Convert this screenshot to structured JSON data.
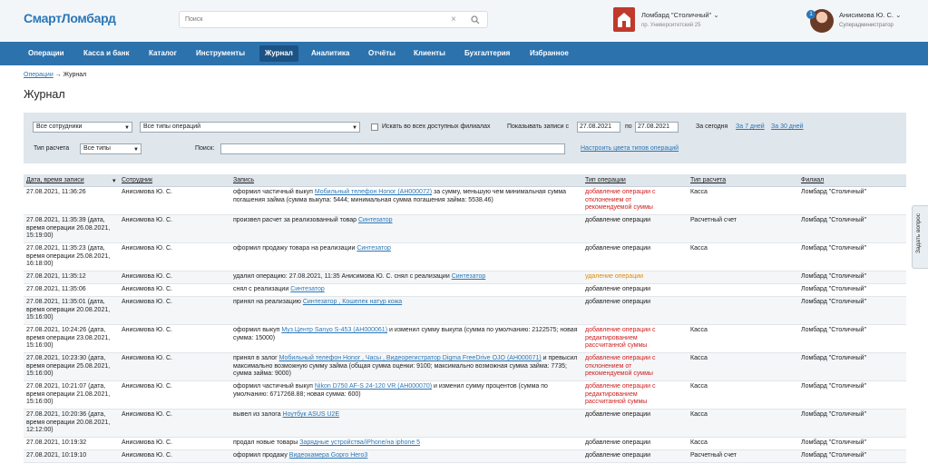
{
  "header": {
    "logo": "СмартЛомбард",
    "search_placeholder": "Поиск",
    "store_name": "Ломбард \"Столичный\"",
    "store_address": "пр. Университетский 25",
    "user_badge": "1",
    "user_name": "Анисимова Ю. С.",
    "user_role": "Суперадминистратор"
  },
  "nav": [
    "Операции",
    "Касса и банк",
    "Каталог",
    "Инструменты",
    "Журнал",
    "Аналитика",
    "Отчёты",
    "Клиенты",
    "Бухгалтерия",
    "Избранное"
  ],
  "nav_active": "Журнал",
  "breadcrumb": {
    "parent": "Операции",
    "separator": "→",
    "current": "Журнал"
  },
  "page_title": "Журнал",
  "filter": {
    "employee": "Все сотрудники",
    "op_type": "Все типы операций",
    "search_all_label": "Искать во всех доступных филиалах",
    "show_records_label": "Показывать записи с",
    "date_from": "27.08.2021",
    "to_label": "по",
    "date_to": "27.08.2021",
    "today": "За сегодня",
    "week": "За 7 дней",
    "month": "За 30 дней",
    "calc_label": "Тип расчета",
    "calc_value": "Все типы",
    "search_label": "Поиск:",
    "colors_link": "Настроить цвета типов операций"
  },
  "columns": [
    "Дата, время записи",
    "Сотрудник",
    "Запись",
    "Тип операции",
    "Тип расчета",
    "Филиал"
  ],
  "rows": [
    {
      "date": "27.08.2021, 11:36:26",
      "emp": "Анисимова Ю. С.",
      "pre": "оформил частичный выкуп ",
      "link": "Мобильный телефон Honor (АН000072)",
      "post": " за сумму, меньшую чем минимальная сумма погашения займа (сумма выкупа: 5444; минимальная сумма погашения займа: 5538.46)",
      "op": "добавление операции с отклонением от рекомендуемой суммы",
      "opc": "red",
      "calc": "Касса",
      "branch": "Ломбард \"Столичный\""
    },
    {
      "date": "27.08.2021, 11:35:39 (дата, время операции 26.08.2021, 15:19:00)",
      "emp": "Анисимова Ю. С.",
      "pre": "произвел расчет за реализованный товар ",
      "link": "Синтезатор",
      "post": "",
      "op": "добавление операции",
      "opc": "",
      "calc": "Расчетный счет",
      "branch": "Ломбард \"Столичный\""
    },
    {
      "date": "27.08.2021, 11:35:23 (дата, время операции 25.08.2021, 16:18:00)",
      "emp": "Анисимова Ю. С.",
      "pre": "оформил продажу товара на реализации ",
      "link": "Синтезатор",
      "post": "",
      "op": "добавление операции",
      "opc": "",
      "calc": "Касса",
      "branch": "Ломбард \"Столичный\""
    },
    {
      "date": "27.08.2021, 11:35:12",
      "emp": "Анисимова Ю. С.",
      "pre": "удалил операцию: 27.08.2021, 11:35 Анисимова Ю. С. снял с реализации ",
      "link": "Синтезатор",
      "post": "",
      "op": "удаление операции",
      "opc": "orange",
      "calc": "",
      "branch": "Ломбард \"Столичный\""
    },
    {
      "date": "27.08.2021, 11:35:06",
      "emp": "Анисимова Ю. С.",
      "pre": "снял с реализации ",
      "link": "Синтезатор",
      "post": "",
      "op": "добавление операции",
      "opc": "",
      "calc": "",
      "branch": "Ломбард \"Столичный\""
    },
    {
      "date": "27.08.2021, 11:35:01 (дата, время операции 20.08.2021, 15:16:00)",
      "emp": "Анисимова Ю. С.",
      "pre": "принял на реализацию ",
      "link": "Синтезатор , Кошелек натур кожа",
      "post": "",
      "op": "добавление операции",
      "opc": "",
      "calc": "",
      "branch": "Ломбард \"Столичный\""
    },
    {
      "date": "27.08.2021, 10:24:26 (дата, время операции 23.08.2021, 15:16:00)",
      "emp": "Анисимова Ю. С.",
      "pre": "оформил выкуп ",
      "link": "Муз.Центр Sanyo S-453 (АН000061)",
      "post": " и изменил сумму выкупа (сумма по умолчанию: 2122575; новая сумма: 15000)",
      "op": "добавление операции с редактированием рассчитанной суммы",
      "opc": "red",
      "calc": "Касса",
      "branch": "Ломбард \"Столичный\""
    },
    {
      "date": "27.08.2021, 10:23:30 (дата, время операции 25.08.2021, 15:16:00)",
      "emp": "Анисимова Ю. С.",
      "pre": "принял в залог ",
      "link": "Мобильный телефон Honor , Часы , Видеорегистратор Digma FreeDrive OJO (АН000071)",
      "post": " и превысил максимально возможную сумму займа (общая сумма оценки: 9100; максимально возможная сумма займа: 7735; сумма займа: 9000)",
      "op": "добавление операции с отклонением от рекомендуемой суммы",
      "opc": "red",
      "calc": "Касса",
      "branch": "Ломбард \"Столичный\""
    },
    {
      "date": "27.08.2021, 10:21:07 (дата, время операции 21.08.2021, 15:16:00)",
      "emp": "Анисимова Ю. С.",
      "pre": "оформил частичный выкуп ",
      "link": "Nikon D750 AF-S 24-120 VR (АН000070)",
      "post": " и изменил сумму процентов (сумма по умолчанию: 6717268.88; новая сумма: 600)",
      "op": "добавление операции с редактированием рассчитанной суммы",
      "opc": "red",
      "calc": "Касса",
      "branch": "Ломбард \"Столичный\""
    },
    {
      "date": "27.08.2021, 10:20:36 (дата, время операции 20.08.2021, 12:12:00)",
      "emp": "Анисимова Ю. С.",
      "pre": "вывел из залога ",
      "link": "Ноутбук ASUS U2E",
      "post": "",
      "op": "добавление операции",
      "opc": "",
      "calc": "Касса",
      "branch": "Ломбард \"Столичный\""
    },
    {
      "date": "27.08.2021, 10:19:32",
      "emp": "Анисимова Ю. С.",
      "pre": "продал новые товары ",
      "link": "Зарядные устройства/iPhone/на iphone 5",
      "post": "",
      "op": "добавление операции",
      "opc": "",
      "calc": "Касса",
      "branch": "Ломбард \"Столичный\""
    },
    {
      "date": "27.08.2021, 10:19:10",
      "emp": "Анисимова Ю. С.",
      "pre": "оформил продажу ",
      "link": "Видеокамера Gopro Hero3",
      "post": "",
      "op": "добавление операции",
      "opc": "",
      "calc": "Расчетный счет",
      "branch": "Ломбард \"Столичный\""
    }
  ],
  "side_tab": "Задать вопрос",
  "colors": {
    "nav": "#2c72ad",
    "nav_active": "#1d5284",
    "link": "#2b77b7",
    "warn": "#d02020",
    "delete": "#e08a00"
  }
}
